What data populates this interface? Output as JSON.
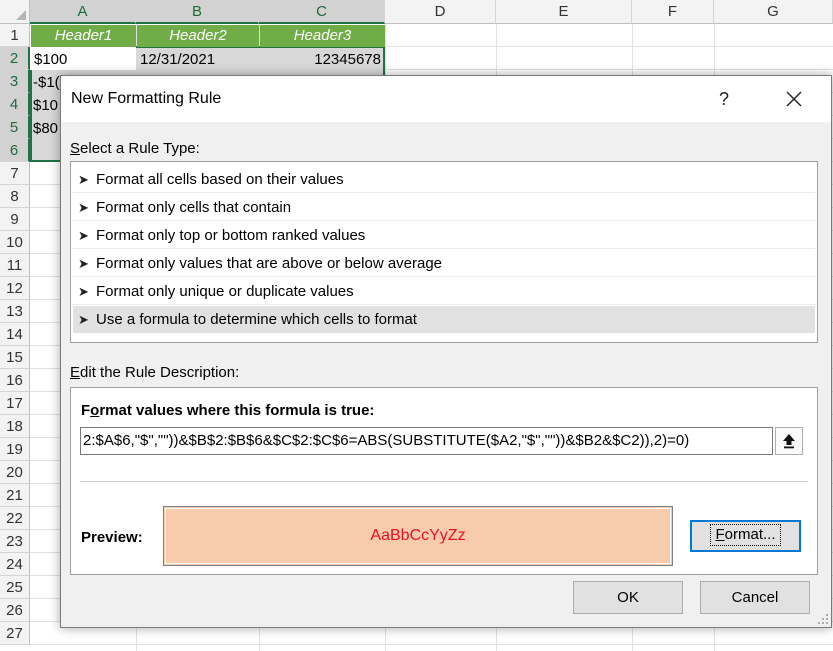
{
  "spreadsheet": {
    "columns": [
      "A",
      "B",
      "C",
      "D",
      "E",
      "F",
      "G"
    ],
    "rows": [
      "1",
      "2",
      "3",
      "4",
      "5",
      "6",
      "7",
      "8",
      "9",
      "10",
      "11",
      "12",
      "13",
      "14",
      "15",
      "16",
      "17",
      "18",
      "19",
      "20",
      "21",
      "22",
      "23",
      "24",
      "25",
      "26",
      "27"
    ],
    "header_row": [
      "Header1",
      "Header2",
      "Header3"
    ],
    "row2": {
      "a": "$100",
      "b": "12/31/2021",
      "c": "12345678"
    },
    "partial_a": {
      "r3": "-$1(",
      "r4": "$10",
      "r5": "$80"
    },
    "colors": {
      "header_fill": "#70ad47",
      "selection_border": "#217346"
    }
  },
  "dialog": {
    "title": "New Formatting Rule",
    "help_glyph": "?",
    "select_label_key": "S",
    "select_label_rest": "elect a Rule Type:",
    "rule_types": [
      "Format all cells based on their values",
      "Format only cells that contain",
      "Format only top or bottom ranked values",
      "Format only values that are above or below average",
      "Format only unique or duplicate values",
      "Use a formula to determine which cells to format"
    ],
    "selected_rule_index": 5,
    "edit_label_key": "E",
    "edit_label_rest": "dit the Rule Description:",
    "formula_title_key": "o",
    "formula_title_pre": "F",
    "formula_title_rest": "rmat values where this formula is true:",
    "formula_value": "2:$A$6,\"$\",\"\"))&$B$2:$B$6&$C$2:$C$6=ABS(SUBSTITUTE($A2,\"$\",\"\"))&$B2&$C2)),2)=0)",
    "preview_label": "Preview:",
    "preview_sample": "AaBbCcYyZz",
    "preview_fill": "#f8cbad",
    "preview_font_color": "#e81123",
    "format_button_key": "F",
    "format_button_rest": "ormat...",
    "ok_label": "OK",
    "cancel_label": "Cancel",
    "icons": {
      "close": "close-icon",
      "collapse": "collapse-dialog-icon",
      "bullet": "arrow-bullet-icon"
    }
  }
}
